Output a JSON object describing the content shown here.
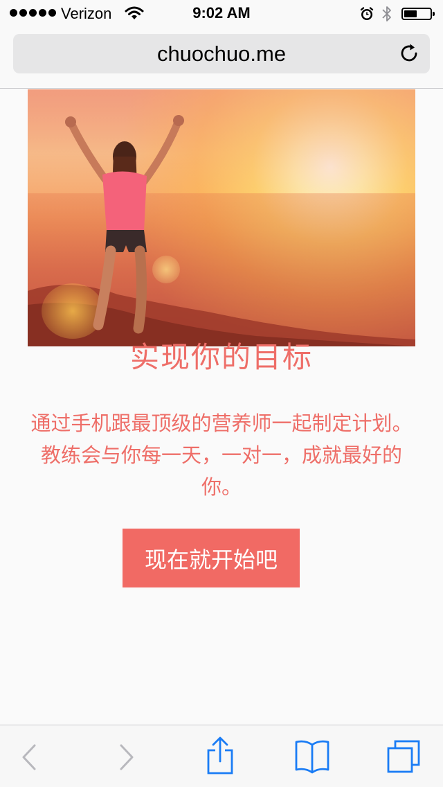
{
  "status_bar": {
    "carrier": "Verizon",
    "time": "9:02 AM",
    "battery_level": 0.52
  },
  "browser": {
    "url": "chuochuo.me"
  },
  "main": {
    "headline": "实现你的目标",
    "description": "通过手机跟最顶级的营养师一起制定计划。教练会与你每一天，一对一，成就最好的你。",
    "cta_label": "现在就开始吧"
  },
  "colors": {
    "accent": "#ee6e68",
    "button": "#f16a64",
    "toolbar_icon": "#1a7cf5",
    "disabled_icon": "#b8b8bd"
  },
  "icons": {
    "signal": "signal-dots-icon",
    "wifi": "wifi-icon",
    "alarm": "alarm-icon",
    "bluetooth": "bluetooth-icon",
    "battery": "battery-icon",
    "reload": "reload-icon",
    "back": "chevron-left-icon",
    "forward": "chevron-right-icon",
    "share": "share-icon",
    "bookmarks": "book-icon",
    "tabs": "tabs-icon"
  }
}
